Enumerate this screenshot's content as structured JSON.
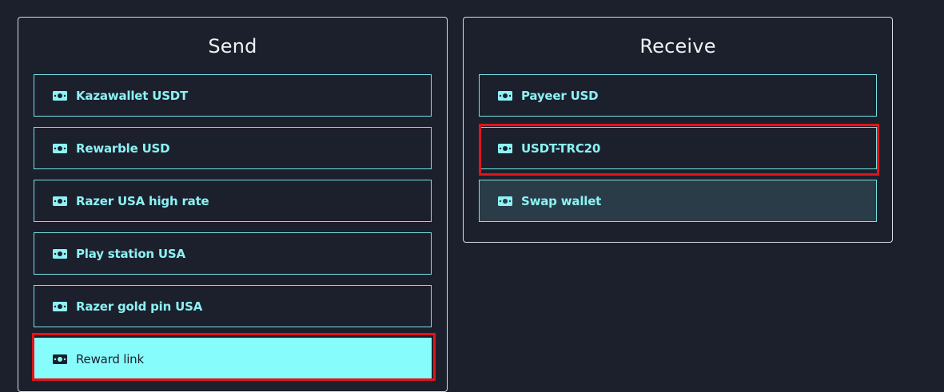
{
  "send": {
    "title": "Send",
    "options": [
      {
        "label": "Kazawallet USDT",
        "icon": "cash-icon"
      },
      {
        "label": "Rewarble USD",
        "icon": "cash-icon"
      },
      {
        "label": "Razer USA high rate",
        "icon": "cash-icon"
      },
      {
        "label": "Play station USA",
        "icon": "cash-icon"
      },
      {
        "label": "Razer gold pin USA",
        "icon": "cash-icon"
      },
      {
        "label": "Reward link",
        "icon": "cash-icon",
        "state": "selected"
      }
    ]
  },
  "receive": {
    "title": "Receive",
    "options": [
      {
        "label": "Payeer USD",
        "icon": "cash-icon"
      },
      {
        "label": "USDT-TRC20",
        "icon": "cash-icon"
      },
      {
        "label": "Swap wallet",
        "icon": "cash-icon",
        "state": "hover"
      }
    ]
  },
  "colors": {
    "background": "#1c202c",
    "accent": "#87fcfd",
    "highlight": "#e1141a"
  }
}
